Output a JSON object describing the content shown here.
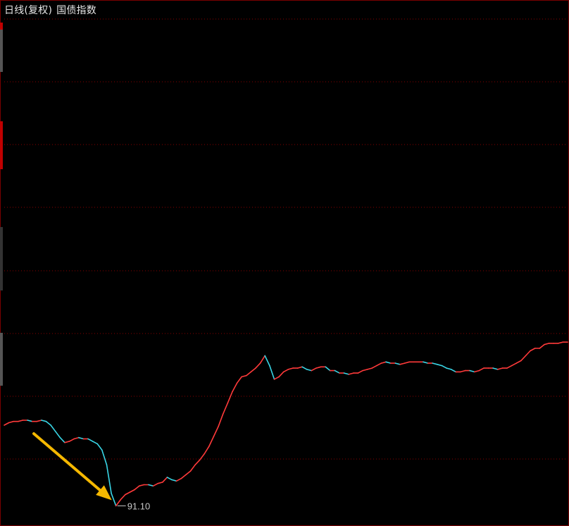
{
  "header": {
    "period_label": "日线(复权)",
    "index_name": "国债指数"
  },
  "colors": {
    "background": "#000000",
    "grid": "#8a0000",
    "frame": "#7a0000",
    "up": "#ff3a3a",
    "down": "#39d6e6",
    "annotation_arrow": "#f5b800",
    "low_label": "#c8c8c8"
  },
  "chart_data": {
    "type": "line",
    "title": "国债指数",
    "subtitle": "日线(复权)",
    "xlabel": "",
    "ylabel": "",
    "ylim": [
      89.7,
      130.4
    ],
    "grid": true,
    "series": [
      {
        "values": [
          97.6,
          97.8,
          97.9,
          97.9,
          98.0,
          98.0,
          97.9,
          97.9,
          98.0,
          97.9,
          97.6,
          97.1,
          96.6,
          96.2,
          96.3,
          96.5,
          96.6,
          96.5,
          96.5,
          96.3,
          96.1,
          95.6,
          94.4,
          92.1,
          91.1,
          91.6,
          92.0,
          92.2,
          92.4,
          92.7,
          92.8,
          92.8,
          92.7,
          92.9,
          93.0,
          93.4,
          93.2,
          93.1,
          93.3,
          93.6,
          93.9,
          94.4,
          94.8,
          95.3,
          95.9,
          96.7,
          97.5,
          98.5,
          99.4,
          100.3,
          101.0,
          101.5,
          101.6,
          101.9,
          102.2,
          102.6,
          103.2,
          102.4,
          101.3,
          101.5,
          101.9,
          102.1,
          102.2,
          102.2,
          102.3,
          102.1,
          102.0,
          102.2,
          102.3,
          102.3,
          102.0,
          102.0,
          101.8,
          101.8,
          101.7,
          101.8,
          101.8,
          102.0,
          102.1,
          102.2,
          102.4,
          102.6,
          102.7,
          102.6,
          102.6,
          102.5,
          102.6,
          102.7,
          102.7,
          102.7,
          102.7,
          102.6,
          102.6,
          102.5,
          102.4,
          102.2,
          102.1,
          101.9,
          101.9,
          102.0,
          102.0,
          101.9,
          102.0,
          102.2,
          102.2,
          102.2,
          102.1,
          102.2,
          102.2,
          102.4,
          102.6,
          102.8,
          103.2,
          103.6,
          103.8,
          103.8,
          104.1,
          104.2,
          104.2,
          104.2,
          104.3,
          104.3
        ]
      }
    ],
    "annotations": [
      {
        "type": "label",
        "text": "91.10",
        "value": 91.1,
        "at_index": 24
      },
      {
        "type": "arrow",
        "points_to_index": 24
      }
    ]
  }
}
